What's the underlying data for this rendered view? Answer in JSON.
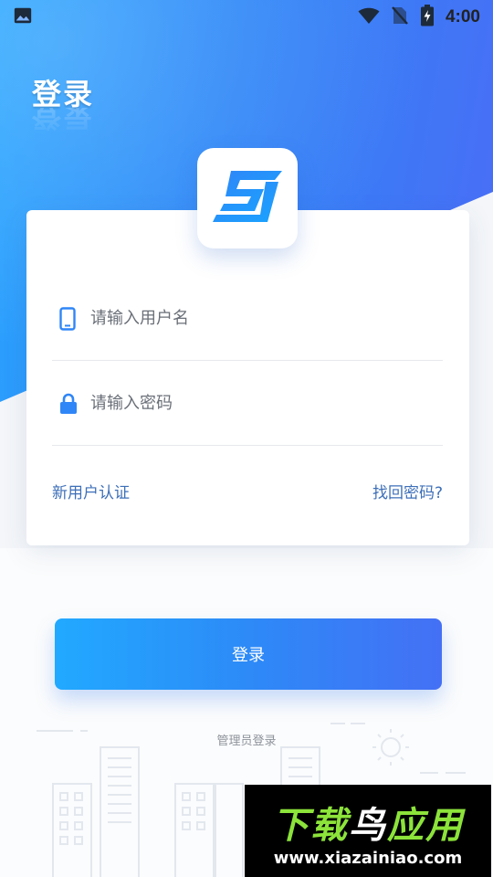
{
  "status_bar": {
    "time": "4:00",
    "icons": [
      "image-icon",
      "wifi-icon",
      "no-sim-icon",
      "battery-charging-icon"
    ]
  },
  "page": {
    "title": "登录"
  },
  "logo": {
    "icon": "app-logo-icon",
    "colors": [
      "#2f86f7",
      "#1aa3ff"
    ]
  },
  "form": {
    "username_placeholder": "请输入用户名",
    "username_icon": "phone-icon",
    "password_placeholder": "请输入密码",
    "password_icon": "lock-icon"
  },
  "links": {
    "new_user": "新用户认证",
    "forgot_password": "找回密码?"
  },
  "login_button": {
    "label": "登录"
  },
  "admin_login": {
    "label": "管理员登录"
  },
  "watermark": {
    "title_part1": "下载",
    "title_part2": "鸟",
    "title_part3": "应用",
    "url": "www.xiazainiao.com"
  },
  "colors": {
    "accent": "#2f86f7",
    "link": "#3d6fb8",
    "button_start": "#21a9ff",
    "button_end": "#4470f5"
  }
}
